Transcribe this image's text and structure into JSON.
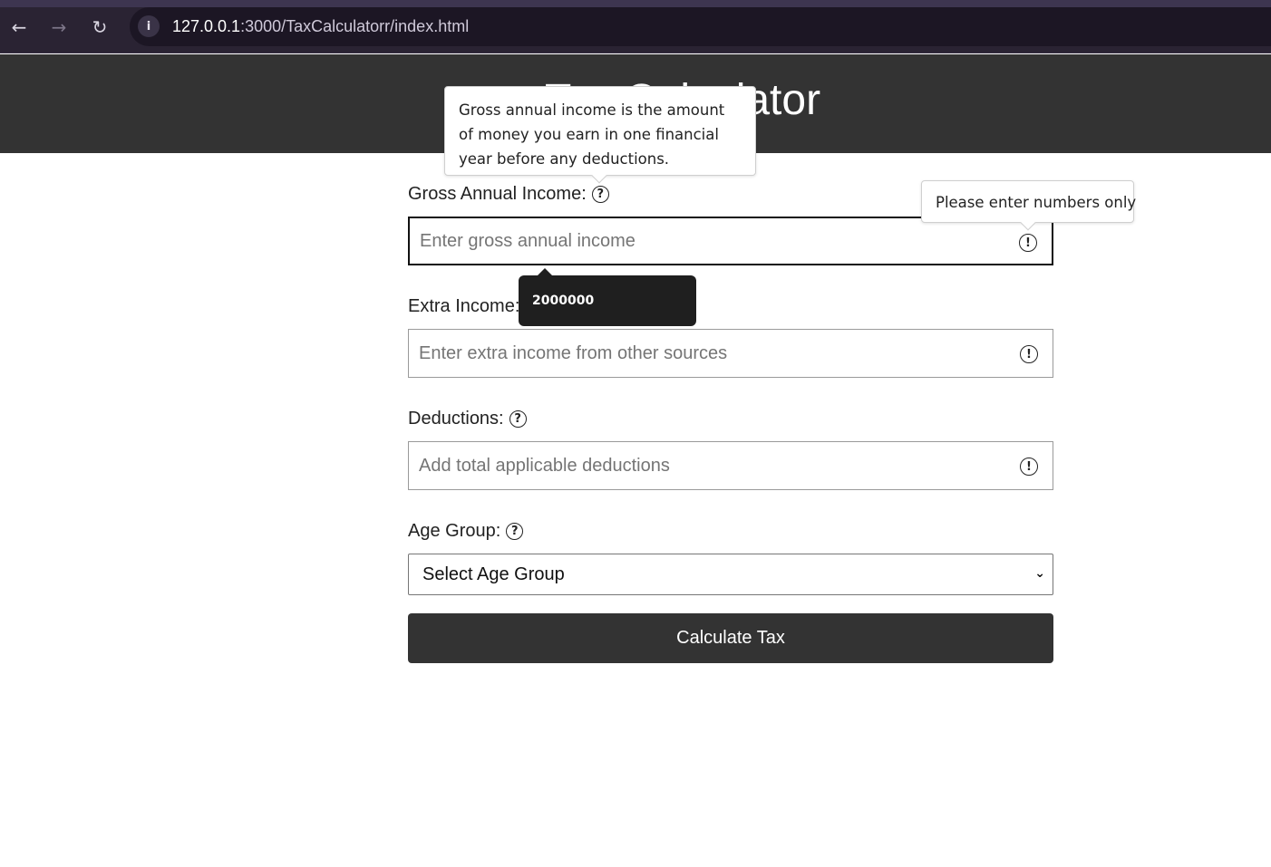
{
  "browser": {
    "back_icon": "←",
    "forward_icon": "→",
    "reload_icon": "↻",
    "info_icon": "i",
    "url_host": "127.0.0.1",
    "url_path": ":3000/TaxCalculatorr/index.html"
  },
  "header": {
    "title": "Tax Calculator"
  },
  "form": {
    "gross_income": {
      "label": "Gross Annual Income:",
      "placeholder": "Enter gross annual income",
      "help_icon": "?",
      "warn_icon": "!"
    },
    "extra_income": {
      "label": "Extra Income:",
      "placeholder": "Enter extra income from other sources",
      "help_icon": "?",
      "warn_icon": "!"
    },
    "deductions": {
      "label": "Deductions:",
      "placeholder": "Add total applicable deductions",
      "help_icon": "?",
      "warn_icon": "!"
    },
    "age_group": {
      "label": "Age Group:",
      "selected": "Select Age Group",
      "help_icon": "?",
      "chevron": "⌄"
    },
    "submit_label": "Calculate Tax"
  },
  "tooltips": {
    "gross_help": "Gross annual income is the amount of money you earn in one financial year before any deductions.",
    "numbers_only": "Please enter numbers only",
    "autofill_value": "2000000"
  }
}
